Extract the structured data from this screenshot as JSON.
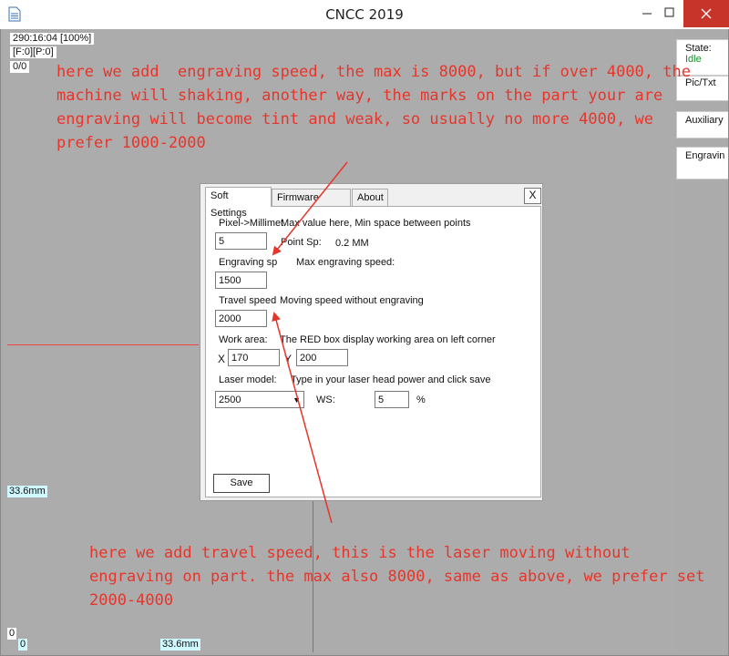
{
  "window": {
    "title": "CNCC 2019",
    "icons": {
      "app": "document-icon",
      "minimize": "minimize-icon",
      "maximize": "maximize-icon",
      "close": "close-icon"
    }
  },
  "status": {
    "position": "290:16:04 [100%]",
    "fp": "[F:0][P:0]",
    "count": "0/0"
  },
  "side_tabs": [
    {
      "label": "State:",
      "value": "Idle",
      "value_color": "#1a8f2a"
    },
    {
      "label": "Pic/Txt"
    },
    {
      "label": "Auxiliary"
    },
    {
      "label": "Engravin"
    }
  ],
  "axes": {
    "y_mm": "33.6mm",
    "x_mm": "33.6mm",
    "zero_y": "0",
    "zero_x": "0"
  },
  "annotations": {
    "top": "here we add  engraving speed, the max is 8000, but if over 4000, the\nmachine will shaking, another way, the marks on the part your are\nengraving will become tint and weak, so usually no more 4000, we\nprefer 1000-2000",
    "bottom": "here we add travel speed, this is the laser moving without\nengraving on part. the max also 8000, same as above, we prefer set\n2000-4000",
    "color": "#e7352b"
  },
  "dialog": {
    "tabs": [
      "Soft Settings",
      "Firmware setting",
      "About"
    ],
    "close": "X",
    "pixel_label": "Pixel->Millimet",
    "pixel_hint": "Max value here, Min space between points",
    "pixel_value": "5",
    "point_sp_label": "Point Sp:",
    "point_sp_value": "0.2 MM",
    "engraving_label": "Engraving spe",
    "engraving_hint": "Max engraving speed:",
    "engraving_value": "1500",
    "travel_label": "Travel speed",
    "travel_hint": "Moving speed without engraving",
    "travel_value": "2000",
    "work_label": "Work area:",
    "work_hint": "The RED box display working area on left corner",
    "x_label": "X",
    "x_value": "170",
    "y_label": "Y",
    "y_value": "200",
    "laser_label": "Laser model:",
    "laser_hint": "Type in your laser head power and click save",
    "laser_value": "2500",
    "ws_label": "WS:",
    "ws_value": "5",
    "ws_unit": "%",
    "save": "Save"
  }
}
